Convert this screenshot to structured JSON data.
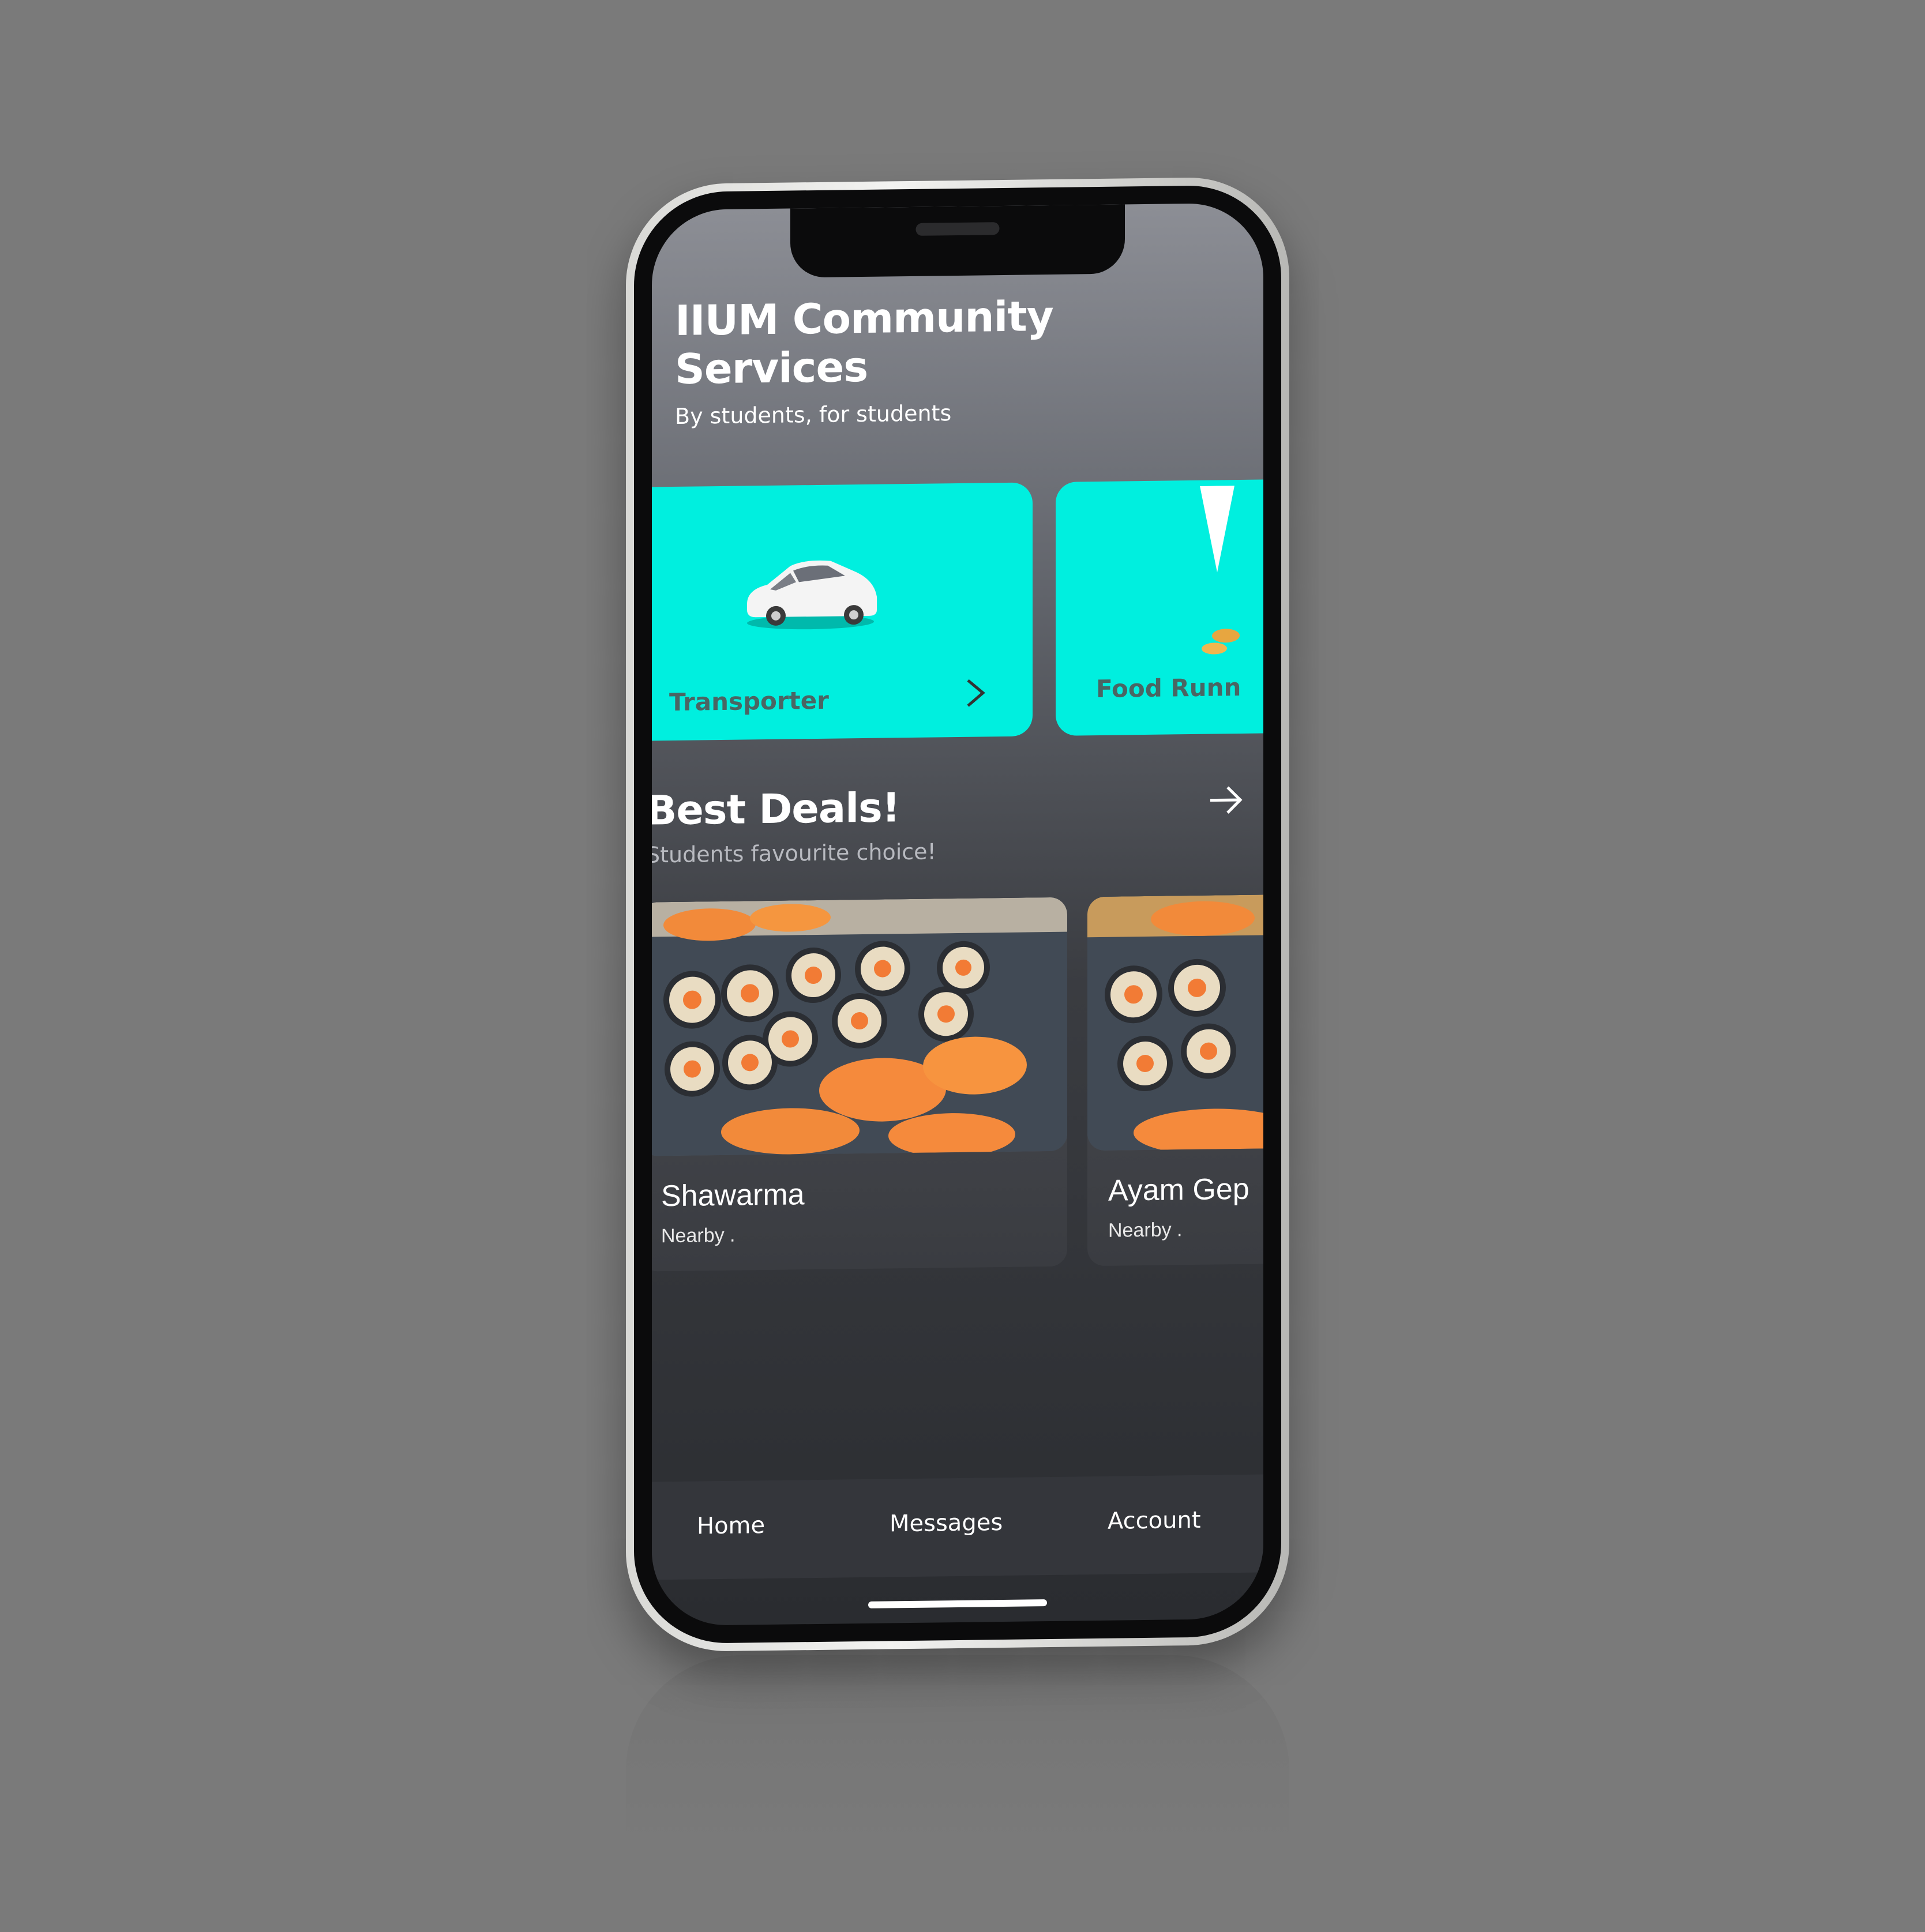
{
  "header": {
    "title": "IIUM Community Services",
    "subtitle": "By students, for students"
  },
  "services": [
    {
      "label": "Transporter",
      "icon": "car-icon",
      "color": "#00efdf"
    },
    {
      "label": "Food Runn",
      "icon": "food-icon",
      "color": "#00efdf"
    }
  ],
  "deals": {
    "title": "Best Deals!",
    "subtitle": "Students favourite choice!",
    "items": [
      {
        "name": "Shawarma",
        "meta": "Nearby ."
      },
      {
        "name": "Ayam Gep",
        "meta": "Nearby ."
      }
    ]
  },
  "tabs": [
    {
      "label": "Home"
    },
    {
      "label": "Messages"
    },
    {
      "label": "Account"
    }
  ],
  "colors": {
    "accent": "#00efdf",
    "background": "#7a7a7a"
  }
}
